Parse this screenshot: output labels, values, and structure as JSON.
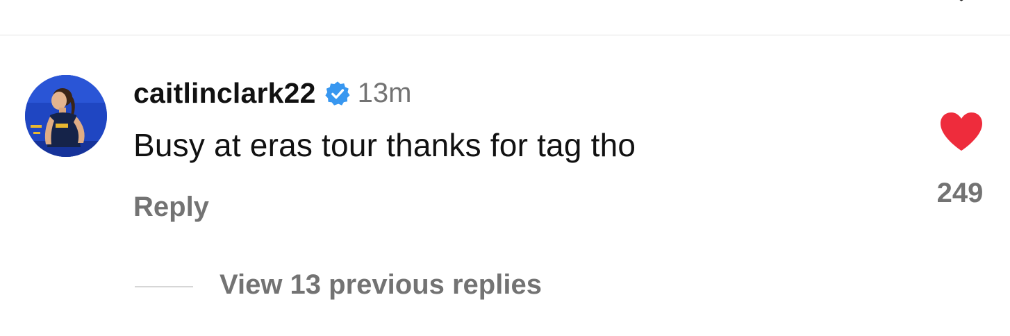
{
  "comment": {
    "username": "caitlinclark22",
    "verified": true,
    "timestamp": "13m",
    "text": "Busy at eras tour thanks for tag tho",
    "reply_label": "Reply",
    "liked": true,
    "like_count": "249",
    "view_replies_label": "View 13 previous replies"
  },
  "icons": {
    "verified": "verified-badge-icon",
    "like": "heart-icon",
    "top_right": "chevron-down-icon"
  },
  "colors": {
    "verified": "#3897f0",
    "heart": "#ee2c3c",
    "secondary_text": "#737373",
    "primary_text": "#111111",
    "avatar_background": "#1f46c2"
  }
}
